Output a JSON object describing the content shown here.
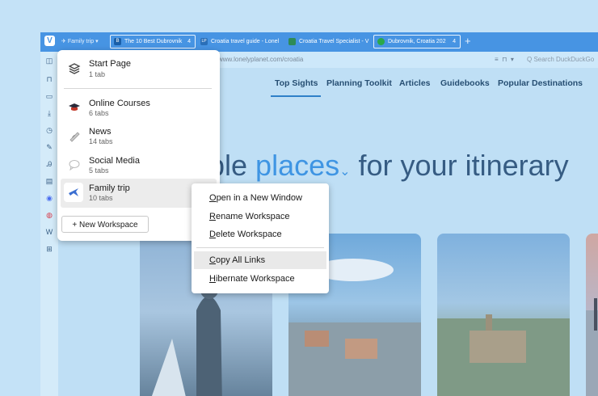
{
  "workspace_indicator": "Family trip",
  "tabs": [
    {
      "title": "The 10 Best Dubrovnik",
      "count": "4",
      "favicon": "B",
      "favicon_color": "#1a5fa8"
    },
    {
      "title": "Croatia travel guide - Lonel",
      "favicon": "LP",
      "favicon_color": "#2a6fb8"
    },
    {
      "title": "Croatia Travel Specialist - V",
      "favicon_color": "#2e8b57"
    },
    {
      "title": "Dubrovnik, Croatia 202",
      "count": "4",
      "favicon_color": "#2aa84a"
    }
  ],
  "new_tab_symbol": "+",
  "address": {
    "url": "www.lonelyplanet.com/croatia",
    "search_placeholder": "Search DuckDuckGo"
  },
  "site_nav": [
    "Top Sights",
    "Planning Toolkit",
    "Articles",
    "Guidebooks",
    "Popular Destinations"
  ],
  "hero": {
    "before": "ple ",
    "highlight": "places",
    "after": " for your itinerary"
  },
  "workspace_menu": {
    "start_page": {
      "title": "Start Page",
      "sub": "1 tab"
    },
    "workspaces": [
      {
        "title": "Online Courses",
        "sub": "6 tabs",
        "icon": "graduation-cap-icon"
      },
      {
        "title": "News",
        "sub": "14 tabs",
        "icon": "newspaper-icon"
      },
      {
        "title": "Social Media",
        "sub": "5 tabs",
        "icon": "chat-bubble-icon"
      },
      {
        "title": "Family trip",
        "sub": "10 tabs",
        "icon": "airplane-icon"
      }
    ],
    "new_workspace": "+ New Workspace"
  },
  "context_menu": {
    "items": [
      {
        "accel": "O",
        "rest": "pen in a New Window"
      },
      {
        "accel": "R",
        "rest": "ename Workspace"
      },
      {
        "accel": "D",
        "rest": "elete Workspace"
      },
      {
        "accel": "C",
        "rest": "opy All Links"
      },
      {
        "accel": "H",
        "rest": "ibernate Workspace"
      }
    ]
  },
  "colors": {
    "accent": "#4794e3",
    "brand_blue": "#3f95e3"
  }
}
